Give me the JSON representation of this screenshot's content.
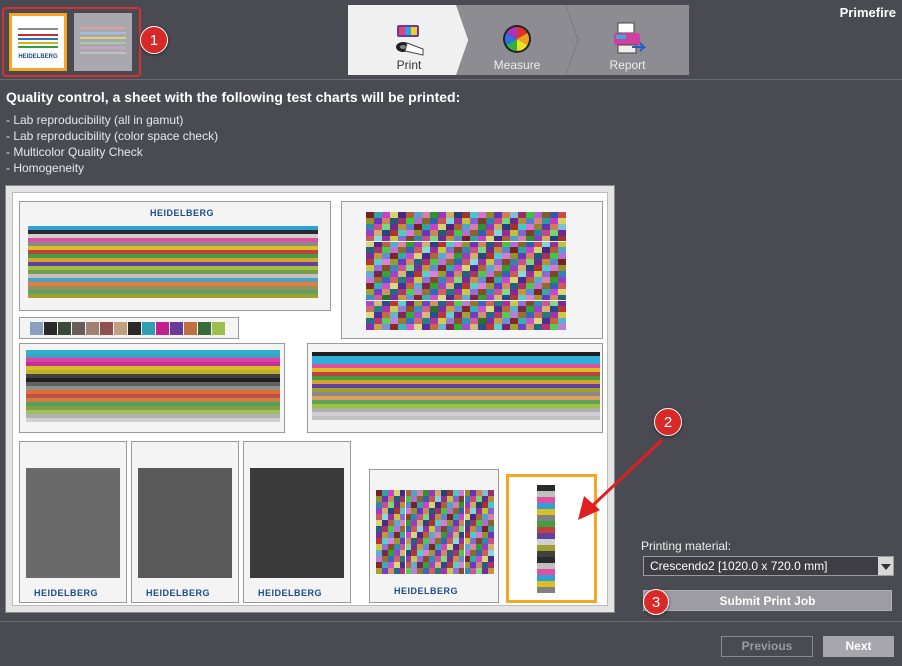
{
  "app": {
    "brand": "Primefire"
  },
  "thumbnails": [
    {
      "name": "sheet-1",
      "selected": true,
      "logo": "HEIDELBERG"
    },
    {
      "name": "sheet-2",
      "selected": false
    }
  ],
  "steps": [
    {
      "label": "Print",
      "active": true,
      "icon": "printer-roll-icon"
    },
    {
      "label": "Measure",
      "active": false,
      "icon": "color-wheel-icon"
    },
    {
      "label": "Report",
      "active": false,
      "icon": "printer-report-icon"
    }
  ],
  "main": {
    "heading": "Quality control, a sheet with the following test charts will be printed:",
    "charts": [
      "- Lab reproducibility (all in gamut)",
      "- Lab reproducibility (color space check)",
      "- Multicolor Quality Check",
      "- Homogeneity"
    ],
    "preview_logos": [
      "HEIDELBERG",
      "HEIDELBERG",
      "HEIDELBERG",
      "HEIDELBERG",
      "HEIDELBERG"
    ]
  },
  "printing_material": {
    "label": "Printing material:",
    "value": "Crescendo2 [1020.0 x 720.0 mm]"
  },
  "actions": {
    "submit": "Submit Print Job"
  },
  "footer": {
    "previous": "Previous",
    "next": "Next"
  },
  "annotations": [
    "1",
    "2",
    "3"
  ],
  "colors": {
    "accent": "#f5a623",
    "callout": "#d82828",
    "background": "#4a4a52"
  }
}
